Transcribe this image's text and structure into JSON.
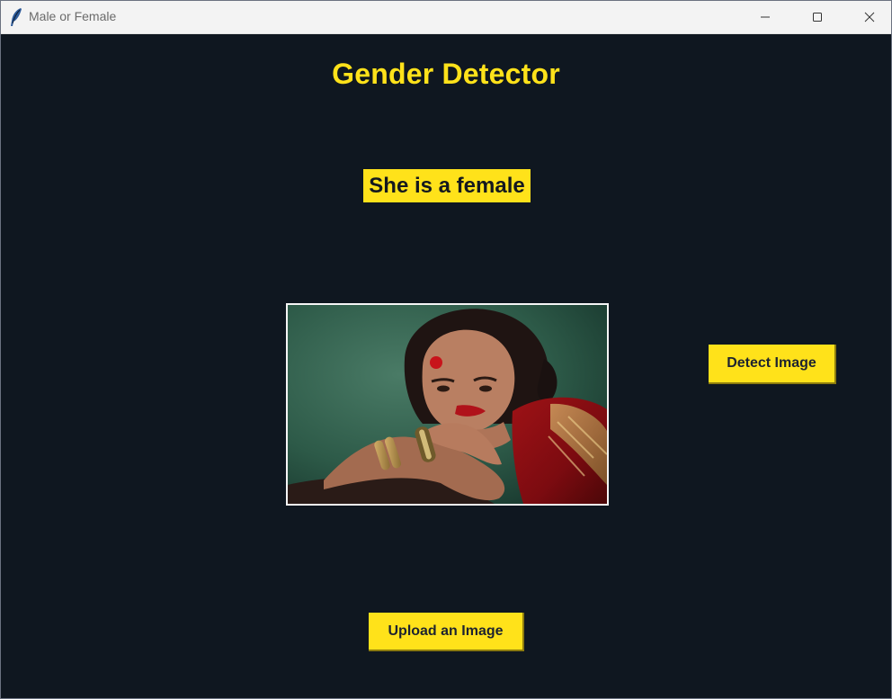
{
  "window": {
    "title": "Male or Female",
    "icon": "feather-icon",
    "controls": [
      "minimize-icon",
      "maximize-icon",
      "close-icon"
    ]
  },
  "main": {
    "heading": "Gender Detector",
    "result_text": "She is a female",
    "image": {
      "description_icon": "uploaded-portrait-image"
    },
    "detect_button": "Detect Image",
    "upload_button": "Upload an Image"
  },
  "colors": {
    "background": "#0f1720",
    "accent": "#ffe21a",
    "button_text": "#1d2330",
    "titlebar": "#f3f3f3"
  }
}
